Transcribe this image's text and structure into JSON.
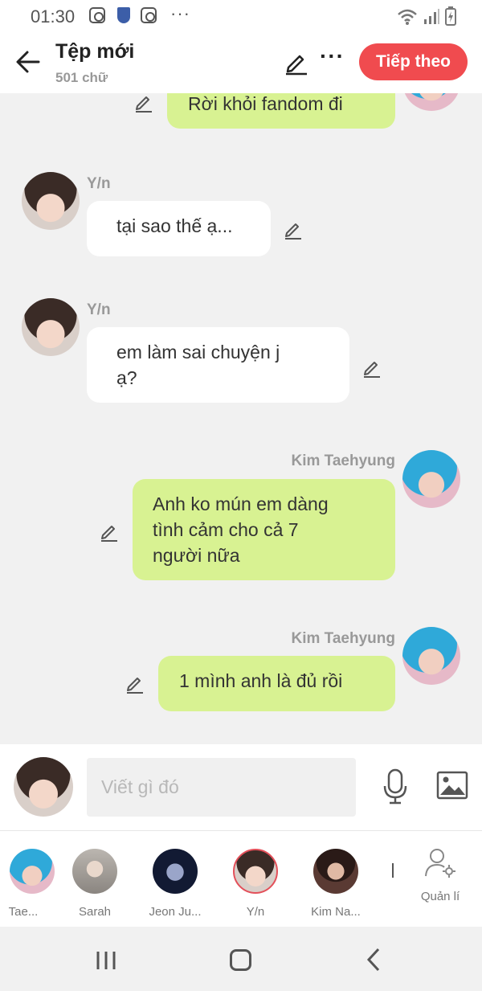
{
  "status_bar": {
    "time": "01:30"
  },
  "header": {
    "title": "Tệp mới",
    "subtitle": "501 chữ",
    "next_label": "Tiếp theo"
  },
  "messages": [
    {
      "side": "out",
      "sender": "",
      "text": "Rời khỏi fandom đi"
    },
    {
      "side": "in",
      "sender": "Y/n",
      "text": "tại sao thế ạ..."
    },
    {
      "side": "in",
      "sender": "Y/n",
      "text": "em làm sai chuyện j\nạ?"
    },
    {
      "side": "out",
      "sender": "Kim Taehyung",
      "text": "Anh ko mún em dàng\ntình cảm cho cả 7\nngười nữa"
    },
    {
      "side": "out",
      "sender": "Kim Taehyung",
      "text": "1 mình anh là đủ rồi"
    }
  ],
  "input": {
    "placeholder": "Viết gì đó"
  },
  "characters": [
    {
      "label": "Tae..."
    },
    {
      "label": "Sarah"
    },
    {
      "label": "Jeon Ju..."
    },
    {
      "label": "Y/n"
    },
    {
      "label": "Kim Na..."
    }
  ],
  "manage_label": "Quản lí",
  "colors": {
    "accent": "#f04b4f",
    "outgoing_bubble": "#d8f292",
    "incoming_bubble": "#ffffff",
    "background": "#f1f1f1"
  }
}
